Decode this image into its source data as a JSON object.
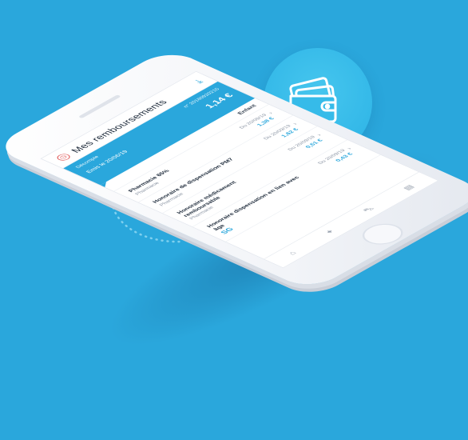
{
  "header": {
    "title_line1": "Mes",
    "title_line2": "remboursements"
  },
  "summary": {
    "label": "Décompte",
    "ref": "n° 20180920215",
    "period": "Emis le 20/06/19",
    "amount": "1,14 €"
  },
  "filter": {
    "label": "Enfant"
  },
  "items": [
    {
      "name": "Pharmacie 65%",
      "category": "Pharmacie",
      "date": "Du 20/09/19",
      "value": "1,38 €"
    },
    {
      "name": "Honoraire de dispensation PM7",
      "category": "Pharmacie",
      "date": "Du 20/09/19",
      "value": "1,62 €"
    },
    {
      "name": "Honoraire médicament remboursable",
      "category": "Pharmacie",
      "date": "Du 20/09/19",
      "value": "0,51 €"
    },
    {
      "name": "Honoraire dispensation en lien avec âge",
      "category": "",
      "date": "Du 20/09/19",
      "value": "0,43 €",
      "logo": "SG"
    }
  ],
  "tabs": [
    "home-icon",
    "wallet-icon",
    "car-icon",
    "card-icon"
  ],
  "colors": {
    "accent": "#2aa7dc",
    "background": "#2aa7dc",
    "alert": "#e05050"
  }
}
